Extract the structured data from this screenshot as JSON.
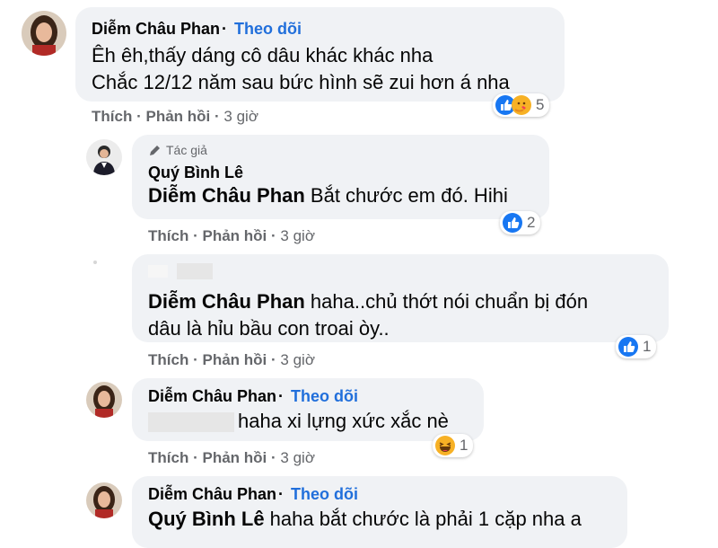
{
  "comments": [
    {
      "name": "Diễm Châu Phan",
      "separator": "·",
      "follow": "Theo dõi",
      "lines": [
        "Êh êh,thấy dáng cô dâu khác khác nha",
        "Chắc 12/12 năm sau bức hình sẽ zui hơn á nha"
      ],
      "like": "Thích",
      "reply": "Phản hồi",
      "time": "3 giờ",
      "reaction_count": "5",
      "reaction_icons": [
        "like-icon",
        "care-icon"
      ]
    },
    {
      "badge": "Tác giả",
      "name": "Quý Bình Lê",
      "mention": "Diễm Châu Phan",
      "text": " Bắt chước em đó. Hihi",
      "like": "Thích",
      "reply": "Phản hồi",
      "time": "3 giờ",
      "reaction_count": "2",
      "reaction_icons": [
        "like-icon"
      ]
    },
    {
      "mention": "Diễm Châu Phan",
      "text": " haha..chủ thớt nói chuẩn bị đón",
      "text2": "dâu là hỉu bầu con troai òy..",
      "like": "Thích",
      "reply": "Phản hồi",
      "time": "3 giờ",
      "reaction_count": "1",
      "reaction_icons": [
        "like-icon"
      ]
    },
    {
      "name": "Diễm Châu Phan",
      "separator": "·",
      "follow": "Theo dõi",
      "text": "haha xi lựng xức xắc nè",
      "like": "Thích",
      "reply": "Phản hồi",
      "time": "3 giờ",
      "reaction_count": "1",
      "reaction_icons": [
        "haha-icon"
      ]
    },
    {
      "name": "Diễm Châu Phan",
      "separator": "·",
      "follow": "Theo dõi",
      "mention": "Quý Bình Lê",
      "text": " haha bắt chước là phải 1 cặp nha a"
    }
  ],
  "meta_separator": "·",
  "colors": {
    "link": "#216fdb",
    "bubble": "#f0f2f5",
    "meta": "#65676b",
    "like": "#1877f2"
  }
}
